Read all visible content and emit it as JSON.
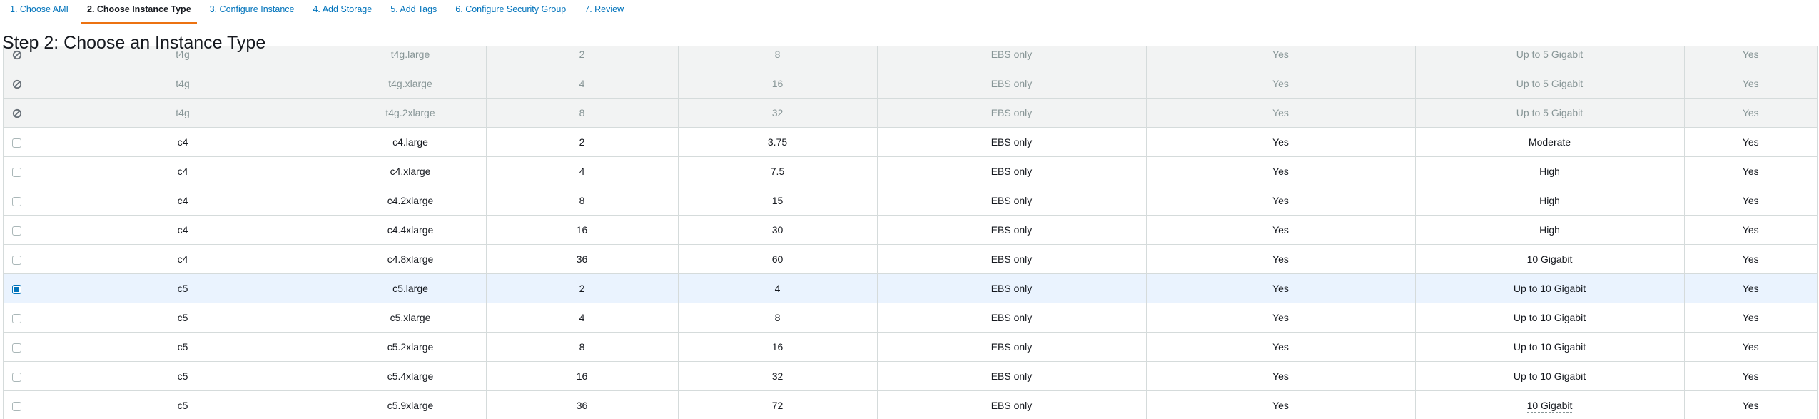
{
  "wizard": {
    "tabs": [
      {
        "label": "1. Choose AMI",
        "active": false
      },
      {
        "label": "2. Choose Instance Type",
        "active": true
      },
      {
        "label": "3. Configure Instance",
        "active": false
      },
      {
        "label": "4. Add Storage",
        "active": false
      },
      {
        "label": "5. Add Tags",
        "active": false
      },
      {
        "label": "6. Configure Security Group",
        "active": false
      },
      {
        "label": "7. Review",
        "active": false
      }
    ]
  },
  "page": {
    "title": "Step 2: Choose an Instance Type"
  },
  "colors": {
    "accent": "#ec7211",
    "link": "#0073bb",
    "selected_row": "#eaf3fe",
    "disabled_row": "#f2f3f3"
  },
  "instances": {
    "rows": [
      {
        "state": "unavailable",
        "family": "t4g",
        "type": "t4g.large",
        "vcpus": "2",
        "memory": "8",
        "storage": "EBS only",
        "ebs_optimized": "Yes",
        "network": "Up to 5 Gigabit",
        "ipv6": "Yes",
        "network_dotted": false
      },
      {
        "state": "unavailable",
        "family": "t4g",
        "type": "t4g.xlarge",
        "vcpus": "4",
        "memory": "16",
        "storage": "EBS only",
        "ebs_optimized": "Yes",
        "network": "Up to 5 Gigabit",
        "ipv6": "Yes",
        "network_dotted": false
      },
      {
        "state": "unavailable",
        "family": "t4g",
        "type": "t4g.2xlarge",
        "vcpus": "8",
        "memory": "32",
        "storage": "EBS only",
        "ebs_optimized": "Yes",
        "network": "Up to 5 Gigabit",
        "ipv6": "Yes",
        "network_dotted": false
      },
      {
        "state": "available",
        "family": "c4",
        "type": "c4.large",
        "vcpus": "2",
        "memory": "3.75",
        "storage": "EBS only",
        "ebs_optimized": "Yes",
        "network": "Moderate",
        "ipv6": "Yes",
        "network_dotted": false
      },
      {
        "state": "available",
        "family": "c4",
        "type": "c4.xlarge",
        "vcpus": "4",
        "memory": "7.5",
        "storage": "EBS only",
        "ebs_optimized": "Yes",
        "network": "High",
        "ipv6": "Yes",
        "network_dotted": false
      },
      {
        "state": "available",
        "family": "c4",
        "type": "c4.2xlarge",
        "vcpus": "8",
        "memory": "15",
        "storage": "EBS only",
        "ebs_optimized": "Yes",
        "network": "High",
        "ipv6": "Yes",
        "network_dotted": false
      },
      {
        "state": "available",
        "family": "c4",
        "type": "c4.4xlarge",
        "vcpus": "16",
        "memory": "30",
        "storage": "EBS only",
        "ebs_optimized": "Yes",
        "network": "High",
        "ipv6": "Yes",
        "network_dotted": false
      },
      {
        "state": "available",
        "family": "c4",
        "type": "c4.8xlarge",
        "vcpus": "36",
        "memory": "60",
        "storage": "EBS only",
        "ebs_optimized": "Yes",
        "network": "10 Gigabit",
        "ipv6": "Yes",
        "network_dotted": true
      },
      {
        "state": "selected",
        "family": "c5",
        "type": "c5.large",
        "vcpus": "2",
        "memory": "4",
        "storage": "EBS only",
        "ebs_optimized": "Yes",
        "network": "Up to 10 Gigabit",
        "ipv6": "Yes",
        "network_dotted": false
      },
      {
        "state": "available",
        "family": "c5",
        "type": "c5.xlarge",
        "vcpus": "4",
        "memory": "8",
        "storage": "EBS only",
        "ebs_optimized": "Yes",
        "network": "Up to 10 Gigabit",
        "ipv6": "Yes",
        "network_dotted": false
      },
      {
        "state": "available",
        "family": "c5",
        "type": "c5.2xlarge",
        "vcpus": "8",
        "memory": "16",
        "storage": "EBS only",
        "ebs_optimized": "Yes",
        "network": "Up to 10 Gigabit",
        "ipv6": "Yes",
        "network_dotted": false
      },
      {
        "state": "available",
        "family": "c5",
        "type": "c5.4xlarge",
        "vcpus": "16",
        "memory": "32",
        "storage": "EBS only",
        "ebs_optimized": "Yes",
        "network": "Up to 10 Gigabit",
        "ipv6": "Yes",
        "network_dotted": false
      },
      {
        "state": "available",
        "family": "c5",
        "type": "c5.9xlarge",
        "vcpus": "36",
        "memory": "72",
        "storage": "EBS only",
        "ebs_optimized": "Yes",
        "network": "10 Gigabit",
        "ipv6": "Yes",
        "network_dotted": true
      }
    ]
  }
}
